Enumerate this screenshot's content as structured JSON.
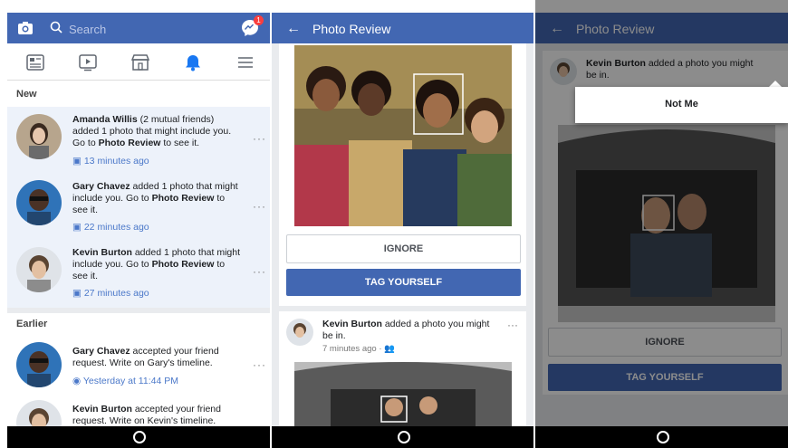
{
  "notifications_screen": {
    "search_placeholder": "Search",
    "messenger_badge": "1",
    "section_new": "New",
    "section_earlier": "Earlier",
    "items": [
      {
        "name": "Amanda Willis",
        "rest": " (2 mutual friends) added 1 photo that might include you. Go to ",
        "link": "Photo Review",
        "end": " to see it.",
        "time": "13 minutes ago"
      },
      {
        "name": "Gary Chavez",
        "rest": " added 1 photo that might include you. Go to ",
        "link": "Photo Review",
        "end": " to see it.",
        "time": "22 minutes ago"
      },
      {
        "name": "Kevin Burton",
        "rest": " added 1 photo that might include you. Go to ",
        "link": "Photo Review",
        "end": " to see it.",
        "time": "27 minutes ago"
      },
      {
        "name": "Gary Chavez",
        "rest": " accepted your friend request. Write on Gary's timeline.",
        "time": "Yesterday at 11:44 PM"
      },
      {
        "name": "Kevin Burton",
        "rest": " accepted your friend request. Write on Kevin's timeline."
      }
    ],
    "more_dots": "···"
  },
  "photo_review_screen": {
    "title": "Photo Review",
    "ignore_label": "IGNORE",
    "tag_label": "TAG YOURSELF",
    "post": {
      "author": "Kevin Burton",
      "text": " added a photo you might be in.",
      "time": "7 minutes ago ·"
    }
  },
  "photo_review_menu": {
    "title": "Photo Review",
    "post_author": "Kevin Burton",
    "post_text": " added a photo you might be in.",
    "menu_option": "Not Me",
    "ignore_label": "IGNORE",
    "tag_label": "TAG YOURSELF"
  },
  "colors": {
    "brand": "#4267b2",
    "unread": "#edf2fa",
    "link": "#4b78c9"
  }
}
